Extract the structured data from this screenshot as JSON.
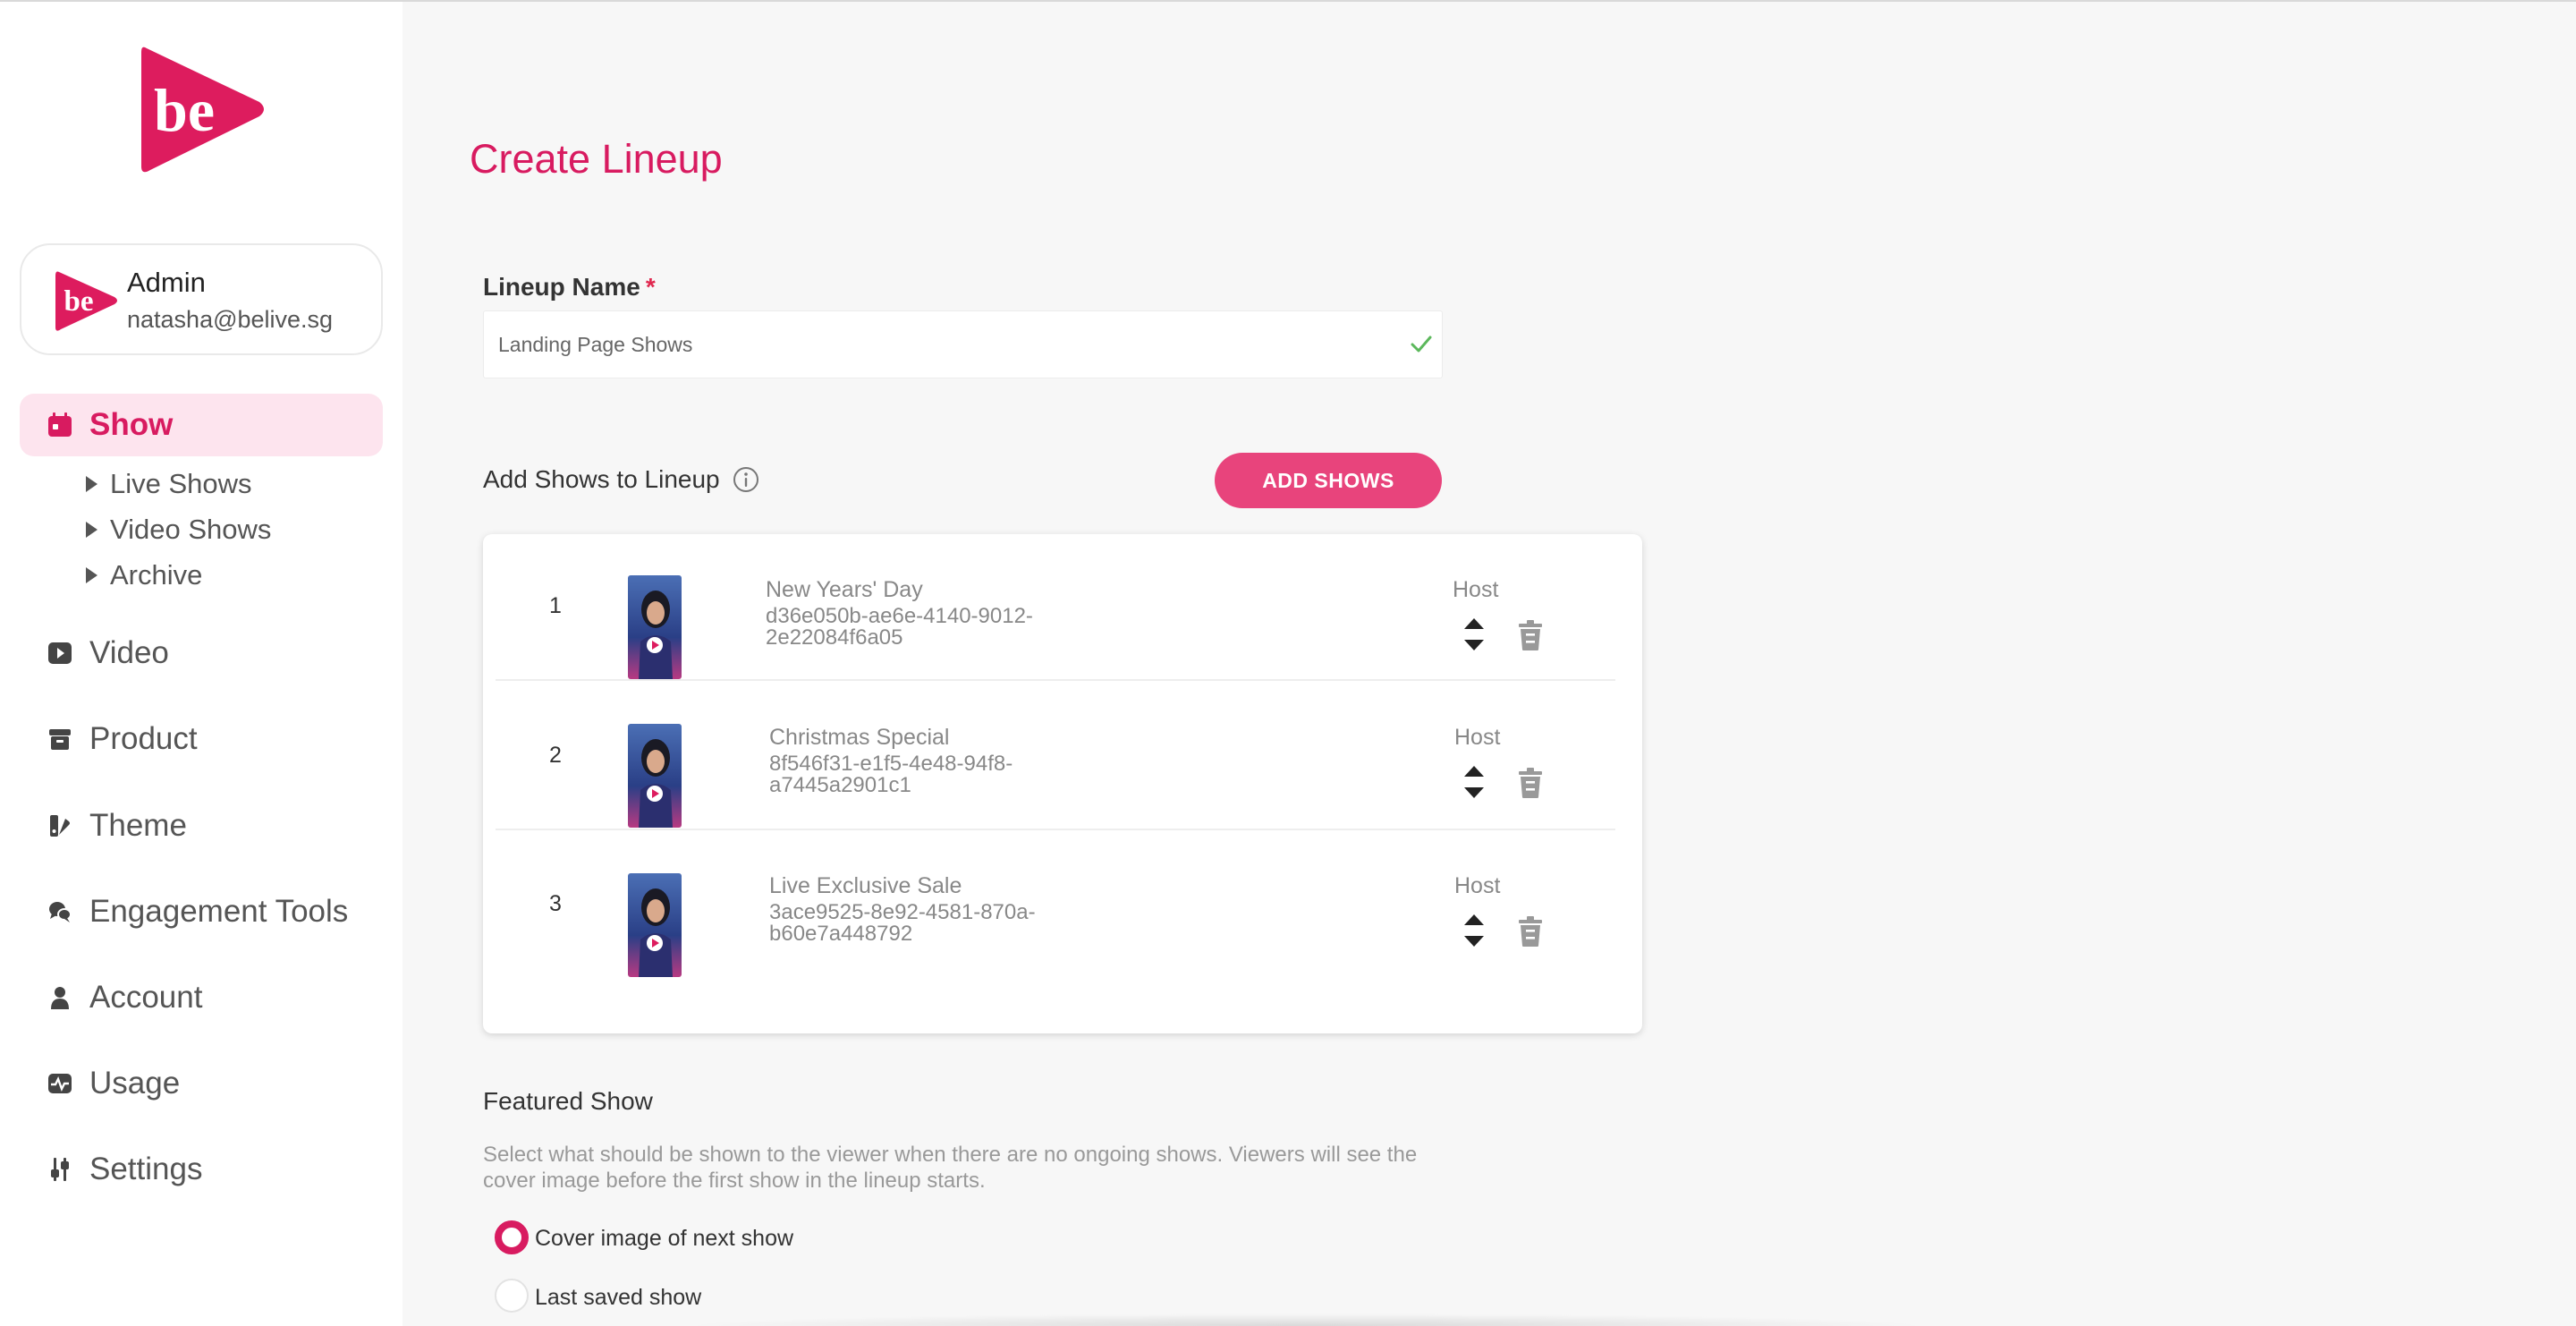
{
  "brand": {
    "accent": "#d81b60",
    "logo_text": "be"
  },
  "user": {
    "name": "Admin",
    "email": "natasha@belive.sg"
  },
  "nav": {
    "show": "Show",
    "sub": {
      "live": "Live Shows",
      "video": "Video Shows",
      "archive": "Archive"
    },
    "video": "Video",
    "product": "Product",
    "theme": "Theme",
    "engagement": "Engagement Tools",
    "account": "Account",
    "usage": "Usage",
    "settings": "Settings"
  },
  "page": {
    "title": "Create Lineup"
  },
  "form": {
    "lineup_name_label": "Lineup Name",
    "required_mark": "*",
    "lineup_name_value": "Landing Page Shows",
    "add_shows_label": "Add Shows to Lineup",
    "add_shows_button": "ADD SHOWS"
  },
  "shows": [
    {
      "index": "1",
      "title": "New Years' Day",
      "id": "d36e050b-ae6e-4140-9012-2e22084f6a05",
      "host": "Host"
    },
    {
      "index": "2",
      "title": "Christmas Special",
      "id": "8f546f31-e1f5-4e48-94f8-a7445a2901c1",
      "host": "Host"
    },
    {
      "index": "3",
      "title": "Live Exclusive Sale",
      "id": "3ace9525-8e92-4581-870a-b60e7a448792",
      "host": "Host"
    }
  ],
  "featured": {
    "title": "Featured Show",
    "description": "Select what should be shown to the viewer when there are no ongoing shows. Viewers will see the cover image before the first show in the lineup starts.",
    "options": [
      {
        "label": "Cover image of next show",
        "selected": true
      },
      {
        "label": "Last saved show",
        "selected": false
      }
    ]
  }
}
